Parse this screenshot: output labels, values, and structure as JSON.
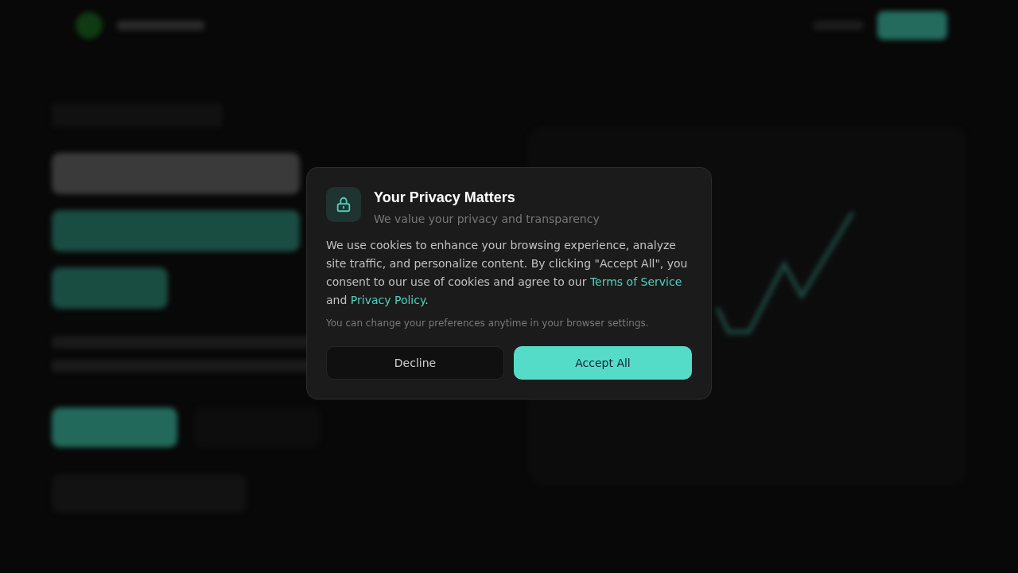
{
  "dialog": {
    "title": "Your Privacy Matters",
    "subtitle": "We value your privacy and transparency",
    "body": [
      {
        "kind": "text",
        "text": "We use cookies to enhance your browsing experience, analyze site traffic, and personalize content. By clicking \"Accept All\", you consent to our use of cookies and agree to our "
      },
      {
        "kind": "link",
        "text": "Terms of Service"
      },
      {
        "kind": "text",
        "text": " and "
      },
      {
        "kind": "link",
        "text": "Privacy Policy"
      },
      {
        "kind": "text",
        "text": "."
      }
    ],
    "note": "You can change your preferences anytime in your browser settings.",
    "buttons": [
      {
        "label": "Decline",
        "kind": "secondary"
      },
      {
        "label": "Accept All",
        "kind": "primary"
      }
    ]
  }
}
